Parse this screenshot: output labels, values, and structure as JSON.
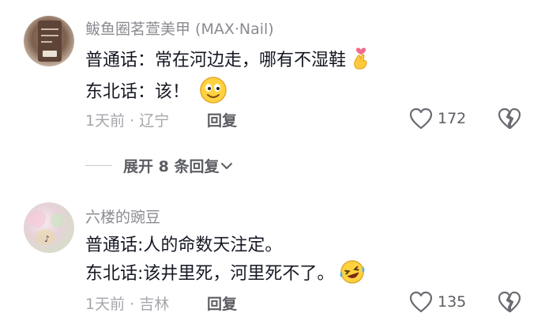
{
  "comments": [
    {
      "username": "鲅鱼圈茗萱美甲 (MAX·Nail)",
      "avatar_icon": "nail-salon-sign-avatar",
      "lines": [
        "普通话：常在河边走，哪有不湿鞋",
        "东北话：该！"
      ],
      "line_emojis": [
        "crossed-fingers-heart-emoji",
        "smiling-face-emoji"
      ],
      "time_location": "1天前 · 辽宁",
      "reply_label": "回复",
      "like_count": "172"
    },
    {
      "username": "六楼的豌豆",
      "avatar_icon": "pastel-photo-avatar",
      "lines": [
        "普通话:人的命数天注定。",
        "东北话:该井里死，河里死不了。"
      ],
      "line_emojis": [
        "",
        "laughing-tears-emoji"
      ],
      "time_location": "1天前 · 吉林",
      "reply_label": "回复",
      "like_count": "135"
    }
  ],
  "expand_replies": {
    "label": "展开 8 条回复"
  },
  "colors": {
    "primary_text": "#161823",
    "secondary_text": "#8a8b91",
    "meta_text": "#a5a6ab",
    "action_text": "#5c5d63"
  }
}
